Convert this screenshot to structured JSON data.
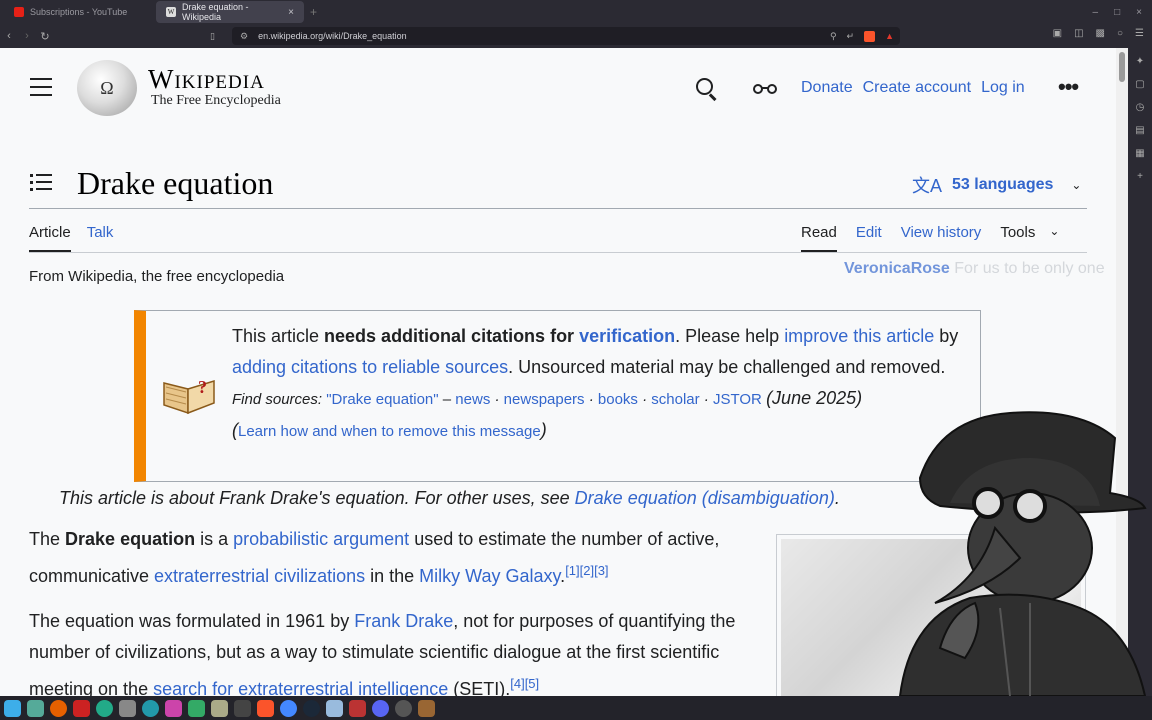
{
  "browser": {
    "tabs": [
      {
        "label": "Subscriptions - YouTube",
        "active": false
      },
      {
        "label": "Drake equation - Wikipedia",
        "active": true
      }
    ],
    "tab_close": "×",
    "new_tab": "+",
    "url": "en.wikipedia.org/wiki/Drake_equation",
    "window_controls": [
      "–",
      "□",
      "×"
    ]
  },
  "header": {
    "wordmark": "Wikipedia",
    "tagline": "The Free Encyclopedia",
    "globe_glyph": "Ω",
    "links": [
      "Donate",
      "Create account",
      "Log in"
    ],
    "more": "•••"
  },
  "article": {
    "title": "Drake equation",
    "languages_label": "53 languages",
    "tabs_left": [
      {
        "label": "Article",
        "selected": true
      },
      {
        "label": "Talk",
        "selected": false
      }
    ],
    "tabs_right": [
      {
        "label": "Read",
        "selected": true
      },
      {
        "label": "Edit",
        "selected": false
      },
      {
        "label": "View history",
        "selected": false
      }
    ],
    "tools_label": "Tools",
    "from": "From Wikipedia, the free encyclopedia"
  },
  "chat": {
    "user": "VeronicaRose",
    "message": "For us to be only one"
  },
  "ambox": {
    "t1": "This article ",
    "t2": "needs additional citations for ",
    "link1": "verification",
    "t3": ". Please help ",
    "link2": "improve this article",
    "t4": " by ",
    "link3": "adding citations to reliable sources",
    "t5": ". Unsourced material may be challenged and removed.",
    "find_label": "Find sources: ",
    "find_query": "\"Drake equation\"",
    "dash": " – ",
    "sources": [
      "news",
      "newspapers",
      "books",
      "scholar",
      "JSTOR"
    ],
    "sep": " · ",
    "date": "(June 2025)",
    "paren_open": "(",
    "learn": "Learn how and when to remove this message",
    "paren_close": ")"
  },
  "hatnote": {
    "text": "This article is about Frank Drake's equation. For other uses, see ",
    "link": "Drake equation (disambiguation)",
    "end": "."
  },
  "para1": {
    "t1": "The ",
    "bold": "Drake equation",
    "t2": " is a ",
    "link1": "probabilistic argument",
    "t3": " used to estimate the number of active, communicative ",
    "link2": "extraterrestrial civilizations",
    "t4": " in the ",
    "link3": "Milky Way Galaxy",
    "t5": ".",
    "refs": "[1][2][3]"
  },
  "para2": {
    "t1": "The equation was formulated in 1961 by ",
    "link1": "Frank Drake",
    "t2": ", not for purposes of quantifying the number of civilizations, but as a way to stimulate scientific dialogue at the first scientific meeting on the ",
    "link2": "search for extraterrestrial intelligence",
    "t3": " (SETI).",
    "refs": "[4][5]"
  },
  "colors": {
    "link": "#3366cc",
    "text": "#202122",
    "ambox_accent": "#f28500",
    "page_bg": "#f8f9fa"
  }
}
